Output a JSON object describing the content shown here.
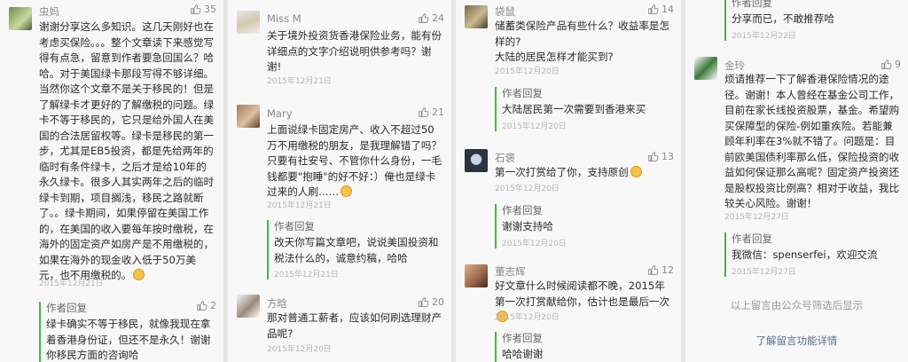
{
  "icons": {
    "like": "thumbs-up-icon",
    "emoji": "smiley-emoji-icon"
  },
  "colors": {
    "reply_bar": "#3dbd3d",
    "link": "#5a6e8f",
    "background": "#f8f8f8"
  },
  "columns": [
    {
      "comments": [
        {
          "nick": "虫妈",
          "likes": "35",
          "text": "谢谢分享这么多知识。这几天刚好也在考虑买保险。。。整个文章读下来感觉写得有点急，留意到作者要急回国么？哈哈。对于美国绿卡那段写得不够详细。当然你这个文章不是关于移民的！但是了解绿卡才更好的了解缴税的问题。绿卡不等于移民的，它只是给外国人在美国的合法居留权等。绿卡是移民的第一步，尤其是EB5投资，都是先给两年的临时有条件绿卡，之后才是给10年的永久绿卡。很多人其实两年之后的临时绿卡到期，项目搁浅，移民之路就断了。。绿卡期间，如果停留在美国工作的，在美国的收入要每年按时缴税，在海外的固定资产如房产是不用缴税的，如果在海外的现金收入低于50万美元，也不用缴税的。",
          "date": "2015年12月21日"
        },
        {
          "like_only": "2",
          "reply": {
            "header": "作者回复",
            "text": "绿卡确实不等于移民，就像我现在拿着香港身份证，但还不是永久！谢谢你移民方面的咨询哈"
          }
        }
      ]
    },
    {
      "comments": [
        {
          "nick": "Miss M",
          "likes": "24",
          "text": "关于境外投资货香港保险业务，能有份详细点的文字介绍说明供参考吗？谢谢!",
          "date": "2015年12月21日"
        },
        {
          "nick": "Mary",
          "likes": "21",
          "text": "上面说绿卡固定房产、收入不超过50万不用缴税的朋友，是我理解错了吗？只要有社安号、不管你什么身份，一毛钱都要\"抱睡\"的好不好：）俺也是绿卡过来的人刷……",
          "date": "2015年12月21日",
          "reply": {
            "header": "作者回复",
            "text": "改天你写篇文章吧，说说美国投资和税法什么的，诚意约稿，哈哈",
            "date": "2015年12月21日"
          }
        },
        {
          "nick": "方晗",
          "likes": "20",
          "text": "那对普通工薪者，应该如何刷选理财产品呢?",
          "date": "2015年12月20日"
        }
      ]
    },
    {
      "comments": [
        {
          "nick": "袋鼠",
          "likes": "14",
          "text": "储蓄类保险产品有些什么？收益率是怎样的?\n大陆的居民怎样才能买到?",
          "date": "2015年12月20日",
          "reply": {
            "header": "作者回复",
            "text": "大陆居民第一次需要到香港来买",
            "date": "2015年12月20日"
          }
        },
        {
          "nick": "石褒",
          "likes": "13",
          "text": "第一次打赏给了你，支持原创",
          "date": "2015年12月20日",
          "reply": {
            "header": "作者回复",
            "text": "谢谢支持哈",
            "date": "2015年12月20日"
          }
        },
        {
          "nick": "董志辉",
          "likes": "12",
          "text": "好文章什么时候阅读都不晚，2015年第一次打赏献给你，估计也是最后一次",
          "date": "2015年12月20日",
          "reply": {
            "header": "作者回复",
            "text": "哈哈谢谢"
          }
        }
      ]
    },
    {
      "comments": [
        {
          "reply": {
            "header": "作者回复",
            "text": "分享而已，不敢推荐哈",
            "date": "2015年12月22日"
          }
        },
        {
          "nick": "金玲",
          "likes": "9",
          "text": "烦请推荐一下了解香港保险情况的途径。谢谢！本人曾经在基金公司工作，目前在家长线投资股票，基金。希望购买保障型的保险-例如重疾险。若能兼顾年利率在3%就不错了。问题是：目前欧美国债利率那么低，保险投资的收益如何保证那么高呢？固定资产投资还是股权投资比例高？相对于收益，我比较关心风险。谢谢！",
          "date": "2015年12月27日",
          "reply": {
            "header": "作者回复",
            "text": "我微信：spenserfei，欢迎交流",
            "date": "2015年12月27日"
          }
        }
      ],
      "footer_note": "以上留言由公众号筛选后显示",
      "footer_link": "了解留言功能详情"
    }
  ]
}
